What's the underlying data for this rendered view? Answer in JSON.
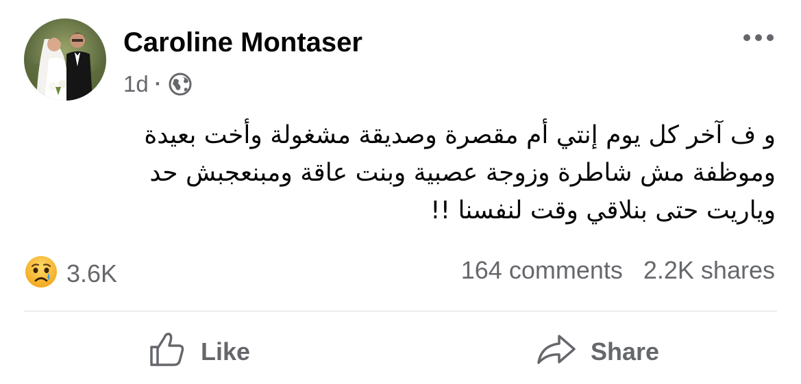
{
  "post": {
    "author": {
      "name": "Caroline Montaser"
    },
    "time": "1d",
    "separator": "·",
    "audience_icon": "globe-icon",
    "more_icon": "more-options-icon",
    "text_lines": [
      "و ف آخر كل يوم إنتي أم مقصرة وصديقة مشغولة وأخت بعيدة",
      "وموظفة مش شاطرة وزوجة عصبية وبنت عاقة ومبنعجبش حد",
      "وياريت حتى بنلاقي وقت لنفسنا !!"
    ]
  },
  "engagement": {
    "reaction_icon": "crying-face-icon",
    "reaction_count": "3.6K",
    "comments": "164 comments",
    "shares": "2.2K shares"
  },
  "actions": {
    "like_label": "Like",
    "share_label": "Share"
  },
  "colors": {
    "text": "#050505",
    "secondary": "#65676b",
    "divider": "#dadde1",
    "reaction_yellow": "#f7b125",
    "tear_blue": "#3b9ae8"
  }
}
